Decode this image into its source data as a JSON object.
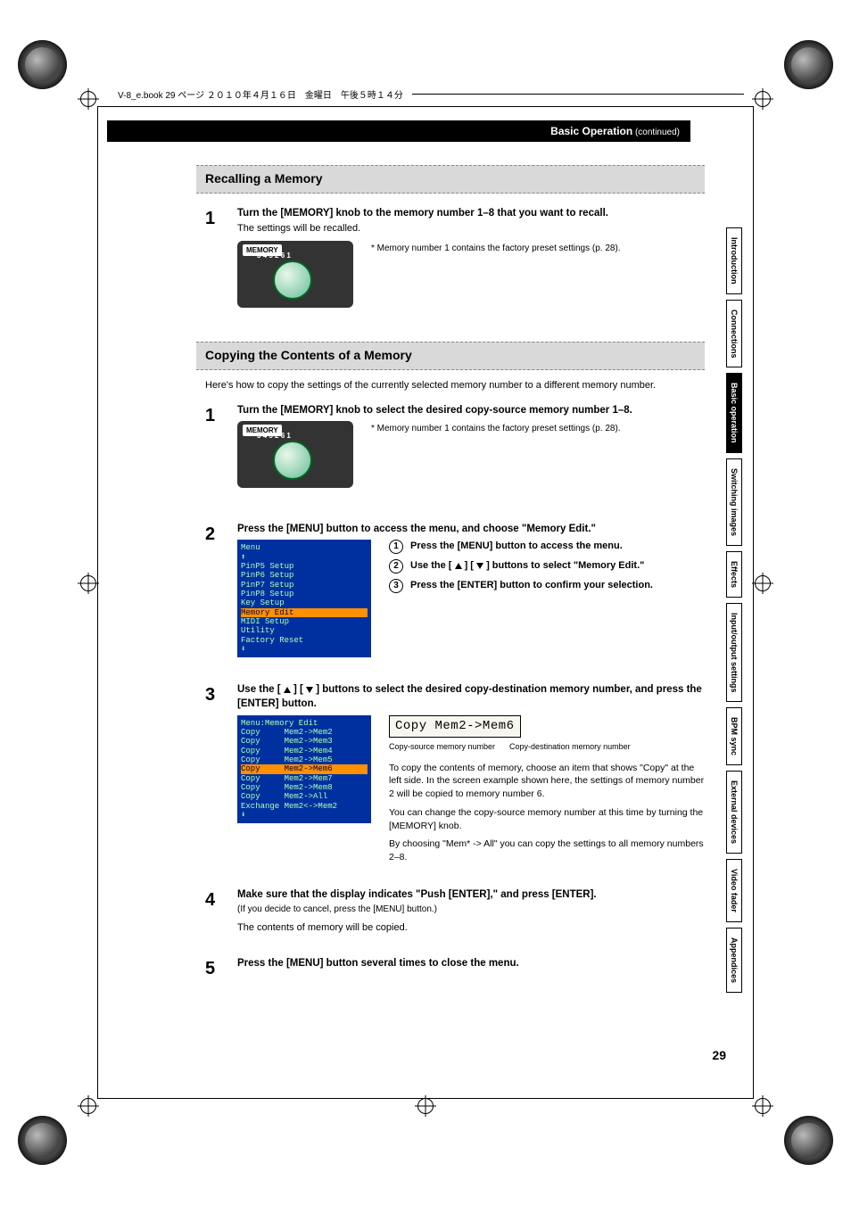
{
  "book_header": "V-8_e.book  29 ページ  ２０１０年４月１６日　金曜日　午後５時１４分",
  "chapter_header": {
    "title": "Basic Operation",
    "cont": " (continued)"
  },
  "sections": {
    "recall": {
      "heading": "Recalling a Memory",
      "step1_bold": "Turn the [MEMORY] knob to the memory number 1–8 that you want to recall.",
      "step1_sub": "The settings will be recalled.",
      "note": "*   Memory number 1 contains the factory preset settings (p. 28).",
      "knob_label": "MEMORY",
      "knob_ticks": "3 4 5\n2       6\n1"
    },
    "copy": {
      "heading": "Copying the Contents of a Memory",
      "intro": "Here's how to copy the settings of the currently selected memory number to a different memory number.",
      "step1_bold": "Turn the [MEMORY] knob to select the desired copy-source memory number 1–8.",
      "note": "*   Memory number 1 contains the factory preset settings (p. 28).",
      "step2_bold": "Press the [MENU] button to access the menu, and choose \"Memory Edit.\"",
      "menu_lines": [
        {
          "t": "Menu",
          "c": "title"
        },
        {
          "t": "⬆",
          "c": "g"
        },
        {
          "t": "PinP5 Setup",
          "c": "g"
        },
        {
          "t": "PinP6 Setup",
          "c": "g"
        },
        {
          "t": "PinP7 Setup",
          "c": "g"
        },
        {
          "t": "PinP8 Setup",
          "c": "g"
        },
        {
          "t": "Key Setup",
          "c": "g"
        },
        {
          "t": "Memory Edit",
          "c": "hl"
        },
        {
          "t": "MIDI Setup",
          "c": "g"
        },
        {
          "t": "Utility",
          "c": "g"
        },
        {
          "t": "Factory Reset",
          "c": "g"
        },
        {
          "t": "⬇",
          "c": "g"
        }
      ],
      "sub1": "Press the [MENU] button to access the menu.",
      "sub2_a": "Use the [ ",
      "sub2_b": " ] [ ",
      "sub2_c": " ] buttons to select \"Memory Edit.\"",
      "sub3": "Press the [ENTER] button to confirm your selection.",
      "step3_bold_a": "Use the [ ",
      "step3_bold_b": " ] [ ",
      "step3_bold_c": " ] buttons to select the desired copy-destination memory number, and press the [ENTER] button.",
      "memedit_title": "Menu:Memory Edit",
      "memedit_lines": [
        {
          "t": "Copy     Mem2->Mem2",
          "c": "g"
        },
        {
          "t": "Copy     Mem2->Mem3",
          "c": "g"
        },
        {
          "t": "Copy     Mem2->Mem4",
          "c": "g"
        },
        {
          "t": "Copy     Mem2->Mem5",
          "c": "g"
        },
        {
          "t": "Copy     Mem2->Mem6",
          "c": "hl"
        },
        {
          "t": "Copy     Mem2->Mem7",
          "c": "g"
        },
        {
          "t": "Copy     Mem2->Mem8",
          "c": "g"
        },
        {
          "t": "Copy     Mem2->All",
          "c": "g"
        },
        {
          "t": "Exchange Mem2<->Mem2",
          "c": "g"
        },
        {
          "t": "⬇",
          "c": "g"
        }
      ],
      "lcd": "Copy     Mem2->Mem6",
      "lcd_cap_left": "Copy-source memory number",
      "lcd_cap_right": "Copy-destination memory number",
      "para1": "To copy the contents of memory, choose an item that shows \"Copy\" at the left side. In the screen example shown here, the settings of memory number 2 will be copied to memory number 6.",
      "para2": "You can change the copy-source memory number at this time by turning the [MEMORY] knob.",
      "para3": "By choosing \"Mem* -> All\" you can copy the settings to all memory numbers 2–8.",
      "step4_bold": "Make sure that the display indicates \"Push [ENTER],\" and press [ENTER].",
      "step4_sub1": "(If you decide to cancel, press the [MENU] button.)",
      "step4_sub2": "The contents of memory will be copied.",
      "step5_bold": "Press the [MENU] button several times to close the menu."
    }
  },
  "side_tabs": [
    "Introduction",
    "Connections",
    "Basic operation",
    "Switching images",
    "Effects",
    "Input/output settings",
    "BPM sync",
    "External devices",
    "Video fader",
    "Appendices"
  ],
  "page_number": "29"
}
